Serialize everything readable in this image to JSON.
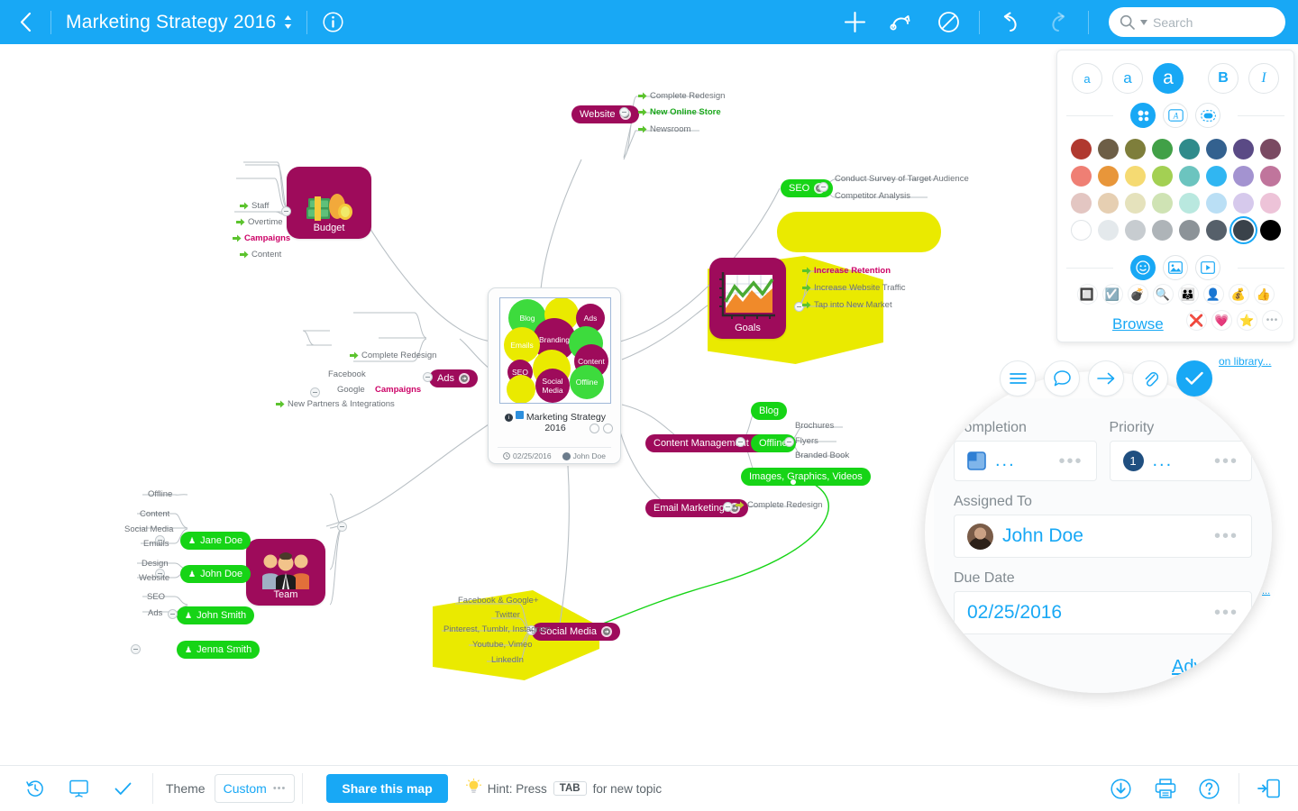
{
  "topbar": {
    "back_icon": "chevron-left-icon",
    "title": "Marketing Strategy 2016",
    "title_caret": "sort-caret-icon",
    "info_icon": "info-circle-icon",
    "tools": [
      {
        "name": "add-topic-button",
        "icon": "plus-icon"
      },
      {
        "name": "relationship-button",
        "icon": "curved-arrow-icon"
      },
      {
        "name": "boundary-button",
        "icon": "no-entry-icon"
      },
      {
        "name": "undo-button",
        "icon": "undo-icon"
      },
      {
        "name": "redo-button",
        "icon": "redo-icon"
      }
    ],
    "search_placeholder": "Search",
    "accent": "#18a8f5"
  },
  "zoom_controls": [
    {
      "name": "zoom-in-button",
      "icon": "plus-icon"
    },
    {
      "name": "zoom-out-button",
      "icon": "minus-icon"
    },
    {
      "name": "shuffle-layout-button",
      "icon": "shuffle-icon"
    },
    {
      "name": "map-settings-button",
      "icon": "gear-icon"
    }
  ],
  "central_topic": {
    "title": "Marketing Strategy 2016",
    "date": "02/25/2016",
    "author": "John Doe",
    "bubbles": [
      {
        "label": "Blog",
        "color": "#3ddb3d"
      },
      {
        "label": "",
        "color": "#eaea00"
      },
      {
        "label": "Ads",
        "color": "#9e0b5b"
      },
      {
        "label": "Branding",
        "color": "#9e0b5b"
      },
      {
        "label": "Emails",
        "color": "#eaea00"
      },
      {
        "label": "",
        "color": "#3ddb3d"
      },
      {
        "label": "Content",
        "color": "#9e0b5b"
      },
      {
        "label": "SEO",
        "color": "#9e0b5b"
      },
      {
        "label": "",
        "color": "#eaea00"
      },
      {
        "label": "Offline",
        "color": "#3ddb3d"
      },
      {
        "label": "Social Media",
        "color": "#9e0b5b"
      },
      {
        "label": "",
        "color": "#eaea00"
      }
    ]
  },
  "branches": {
    "budget": {
      "label": "Budget",
      "children": [
        "Staff",
        "Overtime",
        "Campaigns",
        "Content"
      ],
      "highlighted": "Campaigns"
    },
    "website": {
      "label": "Website",
      "children": [
        "Complete Redesign",
        "New Online Store",
        "Newsroom"
      ],
      "highlighted": "New Online Store"
    },
    "seo": {
      "label": "SEO",
      "children": [
        "Conduct Survey of Target Audience",
        "Competitor Analysis"
      ]
    },
    "goals": {
      "label": "Goals",
      "children": [
        "Increase Retention",
        "Increase Website Traffic",
        "Tap into New Market"
      ],
      "highlighted": "Increase Retention"
    },
    "content_management": {
      "label": "Content Management",
      "children": [
        "Blog",
        "Offline",
        "Images, Graphics, Videos"
      ],
      "offline_children": [
        "Brochures",
        "Flyers",
        "Branded Book"
      ]
    },
    "email_marketing": {
      "label": "Email Marketing",
      "children": [
        "Complete Redesign"
      ]
    },
    "social_media": {
      "label": "Social Media",
      "children": [
        "Facebook & Google+",
        "Twitter",
        "Pinterest, Tumblr, Instagram",
        "Youtube, Vimeo",
        "LinkedIn"
      ]
    },
    "ads": {
      "label": "Ads",
      "children": [
        "Complete Redesign",
        "Campaigns",
        "New Partners & Integrations"
      ],
      "campaign_children": [
        "Facebook",
        "Google"
      ]
    },
    "team": {
      "label": "Team",
      "members": [
        {
          "name": "Jane Doe",
          "tasks": [
            "Offline"
          ]
        },
        {
          "name": "John Doe",
          "tasks": [
            "Content",
            "Social Media",
            "Emails"
          ]
        },
        {
          "name": "John Smith",
          "tasks": [
            "Design",
            "Website"
          ]
        },
        {
          "name": "Jenna Smith",
          "tasks": [
            "SEO",
            "Ads"
          ]
        }
      ]
    }
  },
  "format_panel": {
    "font_sizes": [
      {
        "label": "a",
        "size": "small",
        "selected": false
      },
      {
        "label": "a",
        "size": "medium",
        "selected": false
      },
      {
        "label": "a",
        "size": "large",
        "selected": true
      }
    ],
    "bold_label": "B",
    "italic_label": "I",
    "tabs": [
      {
        "name": "fill-color-tab",
        "icon": "color-dots-icon",
        "selected": true
      },
      {
        "name": "text-color-tab",
        "icon": "letter-a-box-icon",
        "selected": false
      },
      {
        "name": "border-color-tab",
        "icon": "dashed-pill-icon",
        "selected": false
      }
    ],
    "swatch_rows": [
      [
        "#b0392f",
        "#6d5e46",
        "#7e7e3b",
        "#41a047",
        "#2f8b8b",
        "#33618f",
        "#5a4a85",
        "#7a4a62"
      ],
      [
        "#ef7f74",
        "#e8963a",
        "#f5da72",
        "#a3d053",
        "#6cc4bf",
        "#30b6f2",
        "#a393d0",
        "#c0759c"
      ],
      [
        "#e3c6c2",
        "#e6cfb2",
        "#e5e2bc",
        "#cfe3b4",
        "#b9e8df",
        "#badff5",
        "#d6c9ec",
        "#edc3d8"
      ],
      [
        "#ffffff",
        "#e4e9ec",
        "#c7ccd0",
        "#aeb4b8",
        "#8c9398",
        "#56606a",
        "#3a424a",
        "#000000"
      ]
    ],
    "selected_swatch": {
      "row": 3,
      "index": 6
    },
    "media_tabs": [
      {
        "name": "sticker-tab",
        "icon": "smiley-icon",
        "selected": true
      },
      {
        "name": "image-tab",
        "icon": "picture-icon",
        "selected": false
      },
      {
        "name": "video-tab",
        "icon": "video-play-icon",
        "selected": false
      }
    ],
    "stickers_row1": [
      "🔲",
      "☑️",
      "💣",
      "🔍",
      "👪",
      "👤",
      "💰",
      "👍"
    ],
    "stickers_row2": [
      "",
      "",
      "❌",
      "💗",
      "⭐",
      "•••"
    ],
    "browse_label": "Browse",
    "icon_library_label": "on library...",
    "more_label": "..."
  },
  "task_panel": {
    "toolbar": [
      {
        "name": "notes-button",
        "icon": "menu-lines-icon",
        "selected": false
      },
      {
        "name": "comment-button",
        "icon": "speech-bubble-icon",
        "selected": false
      },
      {
        "name": "link-button",
        "icon": "arrow-right-icon",
        "selected": false
      },
      {
        "name": "attachment-button",
        "icon": "paperclip-icon",
        "selected": false
      },
      {
        "name": "task-button",
        "icon": "check-icon",
        "selected": true
      }
    ],
    "completion_label": "Completion",
    "completion_value": "...",
    "priority_label": "Priority",
    "priority_value": "1",
    "priority_ellipsis": "...",
    "assigned_label": "Assigned To",
    "assigned_value": "John Doe",
    "due_label": "Due Date",
    "due_value": "02/25/2016",
    "advanced_label": "Advanced",
    "magic_icon": "magic-wand-icon",
    "dots": "•••"
  },
  "bottombar": {
    "left_icons": [
      {
        "name": "history-button",
        "icon": "clock-history-icon"
      },
      {
        "name": "presentation-button",
        "icon": "presentation-screen-icon"
      },
      {
        "name": "task-filter-button",
        "icon": "check-icon"
      }
    ],
    "theme_label": "Theme",
    "theme_value": "Custom",
    "theme_dots": "•••",
    "share_label": "Share this map",
    "hint_icon": "lightbulb-icon",
    "hint_prefix": "Hint: Press",
    "hint_key": "TAB",
    "hint_suffix": "for new topic",
    "right_icons": [
      {
        "name": "download-button",
        "icon": "download-circle-icon"
      },
      {
        "name": "print-button",
        "icon": "printer-icon"
      },
      {
        "name": "help-button",
        "icon": "question-circle-icon"
      },
      {
        "name": "toggle-panel-button",
        "icon": "panel-collapse-icon"
      }
    ]
  }
}
